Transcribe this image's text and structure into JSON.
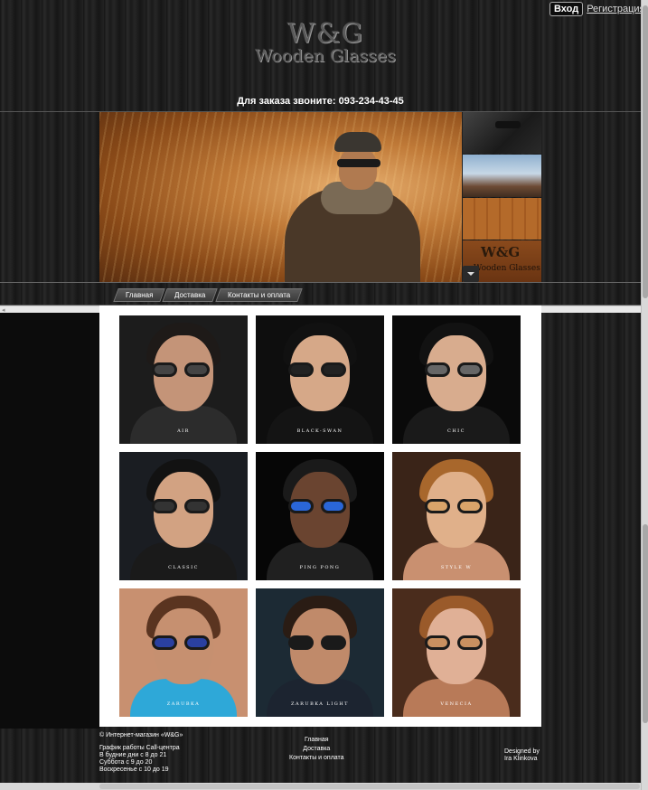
{
  "header": {
    "logo_main": "W&G",
    "logo_sub": "Wooden Glasses",
    "login_label": "Вход",
    "register_label": "Регистрация",
    "phone_text": "Для заказа звоните: 093-234-43-45"
  },
  "banner": {
    "thumb4_logo_main": "W&G",
    "thumb4_logo_sub": "Wooden Glasses"
  },
  "nav": {
    "items": [
      {
        "label": "Главная"
      },
      {
        "label": "Доставка"
      },
      {
        "label": "Контакты и оплата"
      }
    ]
  },
  "products": [
    {
      "name": "AIR",
      "skin": "#c49478",
      "hair": "#1e1a18",
      "body": "#2c2c2c",
      "bg": "#1c1c1c",
      "lens": "#444"
    },
    {
      "name": "BLACK-SWAN",
      "skin": "#d6a888",
      "hair": "#111",
      "body": "#141414",
      "bg": "#0e0e0e",
      "lens": "#222"
    },
    {
      "name": "CHIC",
      "skin": "#d8ac8e",
      "hair": "#121212",
      "body": "#1a1a1a",
      "bg": "#0a0a0a",
      "lens": "#666"
    },
    {
      "name": "CLASSIC",
      "skin": "#d2a282",
      "hair": "#121212",
      "body": "#1a1a1a",
      "bg": "#1a1d22",
      "lens": "#333"
    },
    {
      "name": "PING PONG",
      "skin": "#6a4430",
      "hair": "#1a1a1a",
      "body": "#202020",
      "bg": "#060606",
      "lens": "#2a66d8"
    },
    {
      "name": "STYLE W",
      "skin": "#e0b08a",
      "hair": "#a8672c",
      "body": "#c99070",
      "bg": "#3a2418",
      "lens": "#d9a46a"
    },
    {
      "name": "ZARUBKA",
      "skin": "#c69070",
      "hair": "#5a3420",
      "body": "#2ea8d8",
      "bg": "#c89070",
      "lens": "#2a40a0"
    },
    {
      "name": "ZARUBKA LIGHT",
      "skin": "#c08a6a",
      "hair": "#2a1c14",
      "body": "#1c2430",
      "bg": "#1c2a34",
      "lens": "#1a1a1a"
    },
    {
      "name": "VENECIA",
      "skin": "#e0b096",
      "hair": "#9a5a2a",
      "body": "#b87a58",
      "bg": "#4a2c1c",
      "lens": "#c99060"
    }
  ],
  "footer": {
    "copyright": "© Интернет-магазин «W&G»",
    "schedule_title": "График работы Call-центра",
    "schedule_weekdays": "В будние дни с 8 до 21",
    "schedule_saturday": "Суббота с 9 до 20",
    "schedule_sunday": "Воскресенье с 10 до 19",
    "links": [
      "Главная",
      "Доставка",
      "Контакты и оплата"
    ],
    "designed_by": "Designed by",
    "designer": "Ira Klinkova"
  }
}
